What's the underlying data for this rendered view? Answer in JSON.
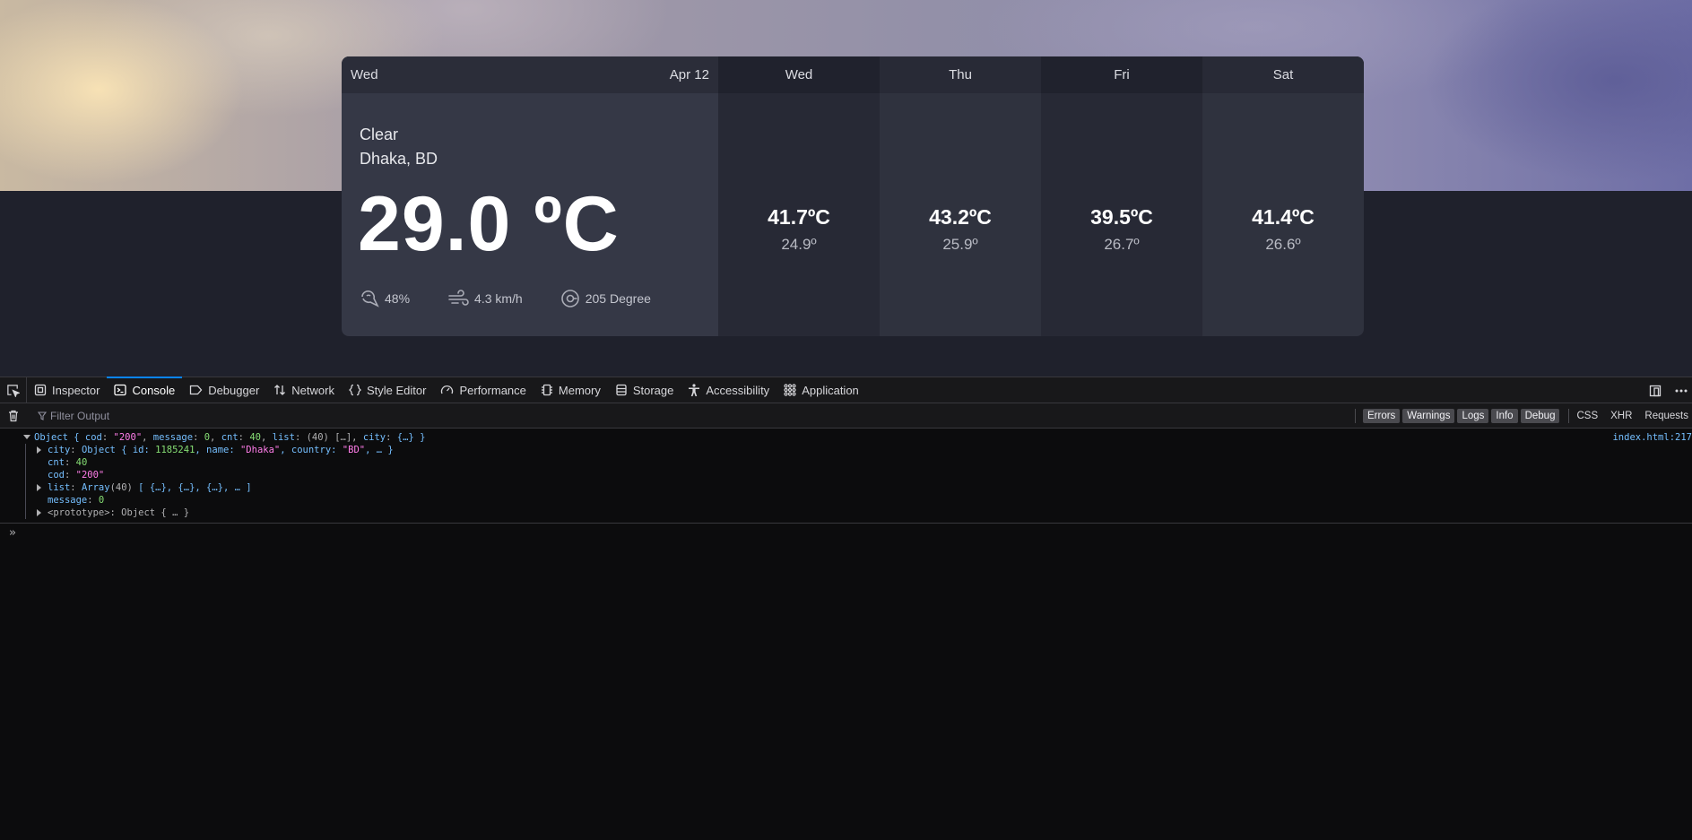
{
  "weather": {
    "today": {
      "day": "Wed",
      "date": "Apr 12",
      "condition": "Clear",
      "location": "Dhaka, BD",
      "temperature": "29.0 ºC",
      "humidity": "48%",
      "wind": "4.3 km/h",
      "direction": "205 Degree"
    },
    "forecast": [
      {
        "day": "Wed",
        "max": "41.7ºC",
        "min": "24.9º"
      },
      {
        "day": "Thu",
        "max": "43.2ºC",
        "min": "25.9º"
      },
      {
        "day": "Fri",
        "max": "39.5ºC",
        "min": "26.7º"
      },
      {
        "day": "Sat",
        "max": "41.4ºC",
        "min": "26.6º"
      }
    ]
  },
  "devtools": {
    "tabs": [
      "Inspector",
      "Console",
      "Debugger",
      "Network",
      "Style Editor",
      "Performance",
      "Memory",
      "Storage",
      "Accessibility",
      "Application"
    ],
    "active_tab": "Console",
    "filter_placeholder": "Filter Output",
    "levels": [
      "Errors",
      "Warnings",
      "Logs",
      "Info",
      "Debug"
    ],
    "filters": [
      "CSS",
      "XHR",
      "Requests"
    ],
    "source_link": "index.html:217",
    "log": {
      "summary_prefix": "Object { ",
      "cod_key": "cod",
      "cod_val": "\"200\"",
      "message_key": "message",
      "message_val": "0",
      "cnt_key": "cnt",
      "cnt_val": "40",
      "list_key": "list",
      "list_val": "(40) […]",
      "city_key": "city",
      "city_val": "{…} }",
      "city_row_key": "city",
      "city_row_val": "Object { id: ",
      "city_id": "1185241",
      "city_name_key": ", name: ",
      "city_name": "\"Dhaka\"",
      "city_country_key": ", country: ",
      "city_country": "\"BD\"",
      "city_tail": ", … }",
      "cnt_row_key": "cnt",
      "cnt_row_val": "40",
      "cod_row_key": "cod",
      "cod_row_val": "\"200\"",
      "list_row_key": "list",
      "list_row_val": "Array",
      "list_row_count": "(40)",
      "list_row_items": " [ {…}, {…}, {…}, … ]",
      "message_row_key": "message",
      "message_row_val": "0",
      "proto_row": "<prototype>: Object { … }"
    }
  }
}
